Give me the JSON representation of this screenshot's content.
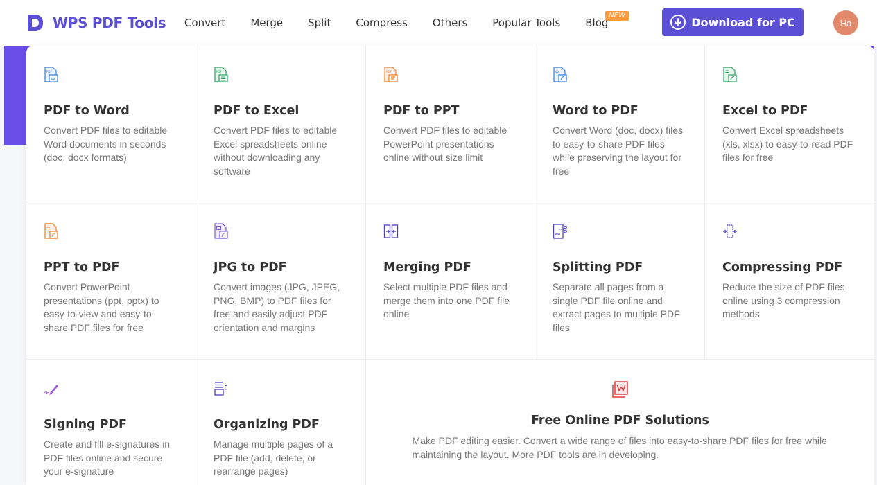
{
  "brand": {
    "name": "WPS PDF Tools",
    "accent": "#5b4fd6"
  },
  "nav": {
    "items": [
      "Convert",
      "Merge",
      "Split",
      "Compress",
      "Others",
      "Popular Tools",
      "Blog"
    ],
    "new_badge": "NEW"
  },
  "header": {
    "download_label": "Download for PC",
    "avatar_initials": "Ha"
  },
  "tools": [
    {
      "title": "PDF to Word",
      "desc": "Convert PDF files to editable Word documents in seconds (doc, docx formats)",
      "icon": "pdf-to-word-icon"
    },
    {
      "title": "PDF to Excel",
      "desc": "Convert PDF files to editable Excel spreadsheets online without downloading any software",
      "icon": "pdf-to-excel-icon"
    },
    {
      "title": "PDF to PPT",
      "desc": "Convert PDF files to editable PowerPoint presentations online without size limit",
      "icon": "pdf-to-ppt-icon"
    },
    {
      "title": "Word to PDF",
      "desc": "Convert Word (doc, docx) files to easy-to-share PDF files while preserving the layout for free",
      "icon": "word-to-pdf-icon"
    },
    {
      "title": "Excel to PDF",
      "desc": "Convert Excel spreadsheets (xls, xlsx) to easy-to-read PDF files for free",
      "icon": "excel-to-pdf-icon"
    },
    {
      "title": "PPT to PDF",
      "desc": "Convert PowerPoint presentations (ppt, pptx) to easy-to-view and easy-to-share PDF files for free",
      "icon": "ppt-to-pdf-icon"
    },
    {
      "title": "JPG to PDF",
      "desc": "Convert images (JPG, JPEG, PNG, BMP) to PDF files for free and easily adjust PDF orientation and margins",
      "icon": "jpg-to-pdf-icon"
    },
    {
      "title": "Merging PDF",
      "desc": "Select multiple PDF files and merge them into one PDF file online",
      "icon": "merge-icon"
    },
    {
      "title": "Splitting PDF",
      "desc": "Separate all pages from a single PDF file online and extract pages to multiple PDF files",
      "icon": "split-icon"
    },
    {
      "title": "Compressing PDF",
      "desc": "Reduce the size of PDF files online using 3 compression methods",
      "icon": "compress-icon"
    },
    {
      "title": "Signing PDF",
      "desc": "Create and fill e-signatures in PDF files online and secure your e-signature",
      "icon": "sign-icon"
    },
    {
      "title": "Organizing PDF",
      "desc": "Manage multiple pages of a PDF file (add, delete, or rearrange pages)",
      "icon": "organize-icon"
    }
  ],
  "solutions": {
    "title": "Free Online PDF Solutions",
    "desc": "Make PDF editing easier. Convert a wide range of files into easy-to-share PDF files for free while maintaining the layout. More PDF tools are in developing.",
    "icon": "pdf-solutions-icon"
  }
}
